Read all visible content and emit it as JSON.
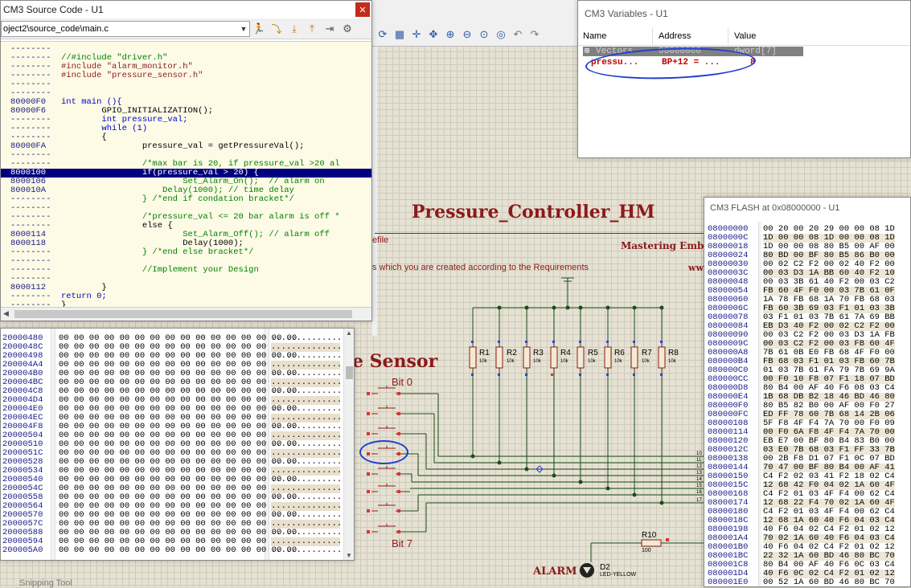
{
  "source_window": {
    "title": "CM3 Source Code - U1",
    "file_path": "oject2\\source_code\\main.c",
    "lines": [
      {
        "addr": "--------",
        "text": "",
        "kind": "plain"
      },
      {
        "addr": "--------",
        "text": "//#include \"driver.h\"",
        "kind": "comment"
      },
      {
        "addr": "--------",
        "text": "#include \"alarm_monitor.h\"",
        "kind": "pre"
      },
      {
        "addr": "--------",
        "text": "#include \"pressure_sensor.h\"",
        "kind": "pre"
      },
      {
        "addr": "--------",
        "text": "",
        "kind": "plain"
      },
      {
        "addr": "--------",
        "text": "",
        "kind": "plain"
      },
      {
        "addr": "80000F0",
        "text": "int main (){",
        "kind": "kwline"
      },
      {
        "addr": "80000F6",
        "text": "        GPIO_INITIALIZATION();",
        "kind": "plain"
      },
      {
        "addr": "--------",
        "text": "        int pressure_val;",
        "kind": "kwline2"
      },
      {
        "addr": "--------",
        "text": "        while (1)",
        "kind": "kwline3"
      },
      {
        "addr": "--------",
        "text": "        {",
        "kind": "plain"
      },
      {
        "addr": "80000FA",
        "text": "                pressure_val = getPressureVal();",
        "kind": "plain"
      },
      {
        "addr": "--------",
        "text": "",
        "kind": "plain"
      },
      {
        "addr": "--------",
        "text": "                /*max bar is 20, if pressure_val >20 al",
        "kind": "comment"
      },
      {
        "addr": "8000100",
        "text": "                if(pressure_val > 20) {",
        "kind": "highlight"
      },
      {
        "addr": "8000106",
        "text": "                        Set_Alarm_On();  // alarm on",
        "kind": "mixed1"
      },
      {
        "addr": "800010A",
        "text": "                    Delay(1000); // time delay",
        "kind": "mixed2"
      },
      {
        "addr": "--------",
        "text": "                } /*end if condation bracket*/",
        "kind": "mixed3"
      },
      {
        "addr": "--------",
        "text": "",
        "kind": "plain"
      },
      {
        "addr": "--------",
        "text": "                /*pressure_val <= 20 bar alarm is off *",
        "kind": "comment"
      },
      {
        "addr": "--------",
        "text": "                else {",
        "kind": "plain"
      },
      {
        "addr": "8000114",
        "text": "                        Set_Alarm_Off(); // alarm off",
        "kind": "mixed4"
      },
      {
        "addr": "8000118",
        "text": "                        Delay(1000);",
        "kind": "plain"
      },
      {
        "addr": "--------",
        "text": "                } /*end else bracket*/",
        "kind": "mixed5"
      },
      {
        "addr": "--------",
        "text": "",
        "kind": "plain"
      },
      {
        "addr": "--------",
        "text": "                //Implement your Design",
        "kind": "comment"
      },
      {
        "addr": "--------",
        "text": "",
        "kind": "plain"
      },
      {
        "addr": "8000112",
        "text": "        }",
        "kind": "plain"
      },
      {
        "addr": "--------",
        "text": "return 0;",
        "kind": "kwline4"
      },
      {
        "addr": "--------",
        "text": "}",
        "kind": "plain"
      }
    ]
  },
  "memory_window": {
    "rows": [
      {
        "addr": "20000480",
        "hex": "00 00 00 00 00 00 00 00 00 00 00 00 00 00 00 00",
        "ascii": "................"
      },
      {
        "addr": "2000048C",
        "hex": "00 00 00 00 00 00 00 00 00 00 00 00 00 00 00 00",
        "ascii": "................"
      },
      {
        "addr": "20000498",
        "hex": "00 00 00 00 00 00 00 00 00 00 00 00 00 00 00 00",
        "ascii": "................"
      },
      {
        "addr": "200004A4",
        "hex": "00 00 00 00 00 00 00 00 00 00 00 00 00 00 00 00",
        "ascii": "................"
      },
      {
        "addr": "200004B0",
        "hex": "00 00 00 00 00 00 00 00 00 00 00 00 00 00 00 00",
        "ascii": "................"
      },
      {
        "addr": "200004BC",
        "hex": "00 00 00 00 00 00 00 00 00 00 00 00 00 00 00 00",
        "ascii": "................"
      },
      {
        "addr": "200004C8",
        "hex": "00 00 00 00 00 00 00 00 00 00 00 00 00 00 00 00",
        "ascii": "................"
      },
      {
        "addr": "200004D4",
        "hex": "00 00 00 00 00 00 00 00 00 00 00 00 00 00 00 00",
        "ascii": "................"
      },
      {
        "addr": "200004E0",
        "hex": "00 00 00 00 00 00 00 00 00 00 00 00 00 00 00 00",
        "ascii": "................"
      },
      {
        "addr": "200004EC",
        "hex": "00 00 00 00 00 00 00 00 00 00 00 00 00 00 00 00",
        "ascii": "................"
      },
      {
        "addr": "200004F8",
        "hex": "00 00 00 00 00 00 00 00 00 00 00 00 00 00 00 00",
        "ascii": "................"
      },
      {
        "addr": "20000504",
        "hex": "00 00 00 00 00 00 00 00 00 00 00 00 00 00 00 00",
        "ascii": "................"
      },
      {
        "addr": "20000510",
        "hex": "00 00 00 00 00 00 00 00 00 00 00 00 00 00 00 00",
        "ascii": "................"
      },
      {
        "addr": "2000051C",
        "hex": "00 00 00 00 00 00 00 00 00 00 00 00 00 00 00 00",
        "ascii": "................"
      },
      {
        "addr": "20000528",
        "hex": "00 00 00 00 00 00 00 00 00 00 00 00 00 00 00 00",
        "ascii": "................"
      },
      {
        "addr": "20000534",
        "hex": "00 00 00 00 00 00 00 00 00 00 00 00 00 00 00 00",
        "ascii": "................"
      },
      {
        "addr": "20000540",
        "hex": "00 00 00 00 00 00 00 00 00 00 00 00 00 00 00 00",
        "ascii": "................"
      },
      {
        "addr": "2000054C",
        "hex": "00 00 00 00 00 00 00 00 00 00 00 00 00 00 00 00",
        "ascii": "................"
      },
      {
        "addr": "20000558",
        "hex": "00 00 00 00 00 00 00 00 00 00 00 00 00 00 00 00",
        "ascii": "................"
      },
      {
        "addr": "20000564",
        "hex": "00 00 00 00 00 00 00 00 00 00 00 00 00 00 00 00",
        "ascii": "................"
      },
      {
        "addr": "20000570",
        "hex": "00 00 00 00 00 00 00 00 00 00 00 00 00 00 00 00",
        "ascii": "................"
      },
      {
        "addr": "2000057C",
        "hex": "00 00 00 00 00 00 00 00 00 00 00 00 00 00 00 00",
        "ascii": "................"
      },
      {
        "addr": "20000588",
        "hex": "00 00 00 00 00 00 00 00 00 00 00 00 00 00 00 00",
        "ascii": "................"
      },
      {
        "addr": "20000594",
        "hex": "00 00 00 00 00 00 00 00 00 00 00 00 00 00 00 00",
        "ascii": "................"
      },
      {
        "addr": "200005A0",
        "hex": "00 00 00 00 00 00 00 00 00 00 00 00 00 00 00 00",
        "ascii": "................"
      }
    ],
    "snipping_label": "Snipping Tool"
  },
  "variables_window": {
    "title": "CM3 Variables - U1",
    "columns": [
      "Name",
      "Address",
      "Value"
    ],
    "rows": [
      {
        "name": "Vectors",
        "address": "08000000",
        "value": "dword[7]"
      },
      {
        "name": "pressu...",
        "address": "BP+12 = ...",
        "value": "8"
      }
    ]
  },
  "flash_window": {
    "title": "CM3 FLASH at 0x08000000 - U1",
    "rows": [
      {
        "addr": "08000000",
        "hex": "00 20 00 20 29 00 00 08 1D"
      },
      {
        "addr": "0800000C",
        "hex": "1D 00 00 08 1D 00 00 08 1D"
      },
      {
        "addr": "08000018",
        "hex": "1D 00 00 08 80 B5 00 AF 00"
      },
      {
        "addr": "08000024",
        "hex": "80 BD 00 BF 80 B5 86 B0 00"
      },
      {
        "addr": "08000030",
        "hex": "00 02 C2 F2 00 02 40 F2 00"
      },
      {
        "addr": "0800003C",
        "hex": "00 03 D3 1A BB 60 40 F2 10"
      },
      {
        "addr": "08000048",
        "hex": "00 03 3B 61 40 F2 00 03 C2"
      },
      {
        "addr": "08000054",
        "hex": "FB 60 4F F0 00 03 7B 61 0F"
      },
      {
        "addr": "08000060",
        "hex": "1A 78 FB 68 1A 70 FB 68 03"
      },
      {
        "addr": "0800006C",
        "hex": "FB 60 3B 69 03 F1 01 03 3B"
      },
      {
        "addr": "08000078",
        "hex": "03 F1 01 03 7B 61 7A 69 BB"
      },
      {
        "addr": "08000084",
        "hex": "EB D3 40 F2 00 02 C2 F2 00"
      },
      {
        "addr": "08000090",
        "hex": "00 03 C2 F2 00 03 D3 1A FB"
      },
      {
        "addr": "0800009C",
        "hex": "00 03 C2 F2 00 03 FB 60 4F"
      },
      {
        "addr": "080000A8",
        "hex": "7B 61 0B E0 FB 68 4F F0 00"
      },
      {
        "addr": "080000B4",
        "hex": "FB 68 03 F1 01 03 FB 60 7B"
      },
      {
        "addr": "080000C0",
        "hex": "01 03 7B 61 FA 79 7B 69 9A"
      },
      {
        "addr": "080000CC",
        "hex": "00 F0 10 F8 07 F1 18 07 BD"
      },
      {
        "addr": "080000D8",
        "hex": "80 B4 00 AF 40 F6 08 03 C4"
      },
      {
        "addr": "080000E4",
        "hex": "1B 68 DB B2 18 46 BD 46 80"
      },
      {
        "addr": "080000F0",
        "hex": "80 B5 82 B0 00 AF 00 F0 27"
      },
      {
        "addr": "080000FC",
        "hex": "ED FF 78 60 7B 68 14 2B 06"
      },
      {
        "addr": "08000108",
        "hex": "5F F8 4F F4 7A 70 00 F0 09"
      },
      {
        "addr": "08000114",
        "hex": "00 F0 6A F8 4F F4 7A 70 00"
      },
      {
        "addr": "08000120",
        "hex": "EB E7 00 BF 80 B4 83 B0 00"
      },
      {
        "addr": "0800012C",
        "hex": "03 E0 7B 68 03 F1 FF 33 7B"
      },
      {
        "addr": "08000138",
        "hex": "00 2B F8 D1 07 F1 0C 07 BD"
      },
      {
        "addr": "08000144",
        "hex": "70 47 00 BF 80 B4 00 AF 41"
      },
      {
        "addr": "08000150",
        "hex": "C4 F2 02 03 41 F2 18 02 C4"
      },
      {
        "addr": "0800015C",
        "hex": "12 68 42 F0 04 02 1A 60 4F"
      },
      {
        "addr": "08000168",
        "hex": "C4 F2 01 03 4F F4 00 62 C4"
      },
      {
        "addr": "08000174",
        "hex": "12 68 22 F4 70 02 1A 60 4F"
      },
      {
        "addr": "08000180",
        "hex": "C4 F2 01 03 4F F4 00 62 C4"
      },
      {
        "addr": "0800018C",
        "hex": "12 68 1A 60 40 F6 04 03 C4"
      },
      {
        "addr": "08000198",
        "hex": "40 F6 04 02 C4 F2 01 02 12"
      },
      {
        "addr": "080001A4",
        "hex": "70 02 1A 60 40 F6 04 03 C4"
      },
      {
        "addr": "080001B0",
        "hex": "40 F6 04 02 C4 F2 01 02 12"
      },
      {
        "addr": "080001BC",
        "hex": "22 32 1A 60 BD 46 80 BC 70"
      },
      {
        "addr": "080001C8",
        "hex": "80 B4 00 AF 40 F6 0C 03 C4"
      },
      {
        "addr": "080001D4",
        "hex": "40 F6 0C 02 C4 F2 01 02 12"
      },
      {
        "addr": "080001E0",
        "hex": "00 52 1A 60 BD 46 80 BC 70"
      }
    ]
  },
  "schematic": {
    "menu_help": "elp",
    "title": "Pressure_Controller_HM",
    "mastering": "Mastering Embe",
    "efile": "efile",
    "requirements": "s which you are created according to the Requirements",
    "www": "ww",
    "sensor": "e Sensor",
    "bit0": "Bit 0",
    "bit7": "Bit 7",
    "alarm": "ALARM",
    "d2": "D2",
    "led": "LED-YELLOW",
    "r10": "R10",
    "r10_val": "100",
    "resistors": [
      {
        "name": "R1",
        "val": "10k"
      },
      {
        "name": "R2",
        "val": "10k"
      },
      {
        "name": "R3",
        "val": "10k"
      },
      {
        "name": "R4",
        "val": "10k"
      },
      {
        "name": "R5",
        "val": "10k"
      },
      {
        "name": "R6",
        "val": "10k"
      },
      {
        "name": "R7",
        "val": "10k"
      },
      {
        "name": "R8",
        "val": "10k"
      }
    ]
  }
}
